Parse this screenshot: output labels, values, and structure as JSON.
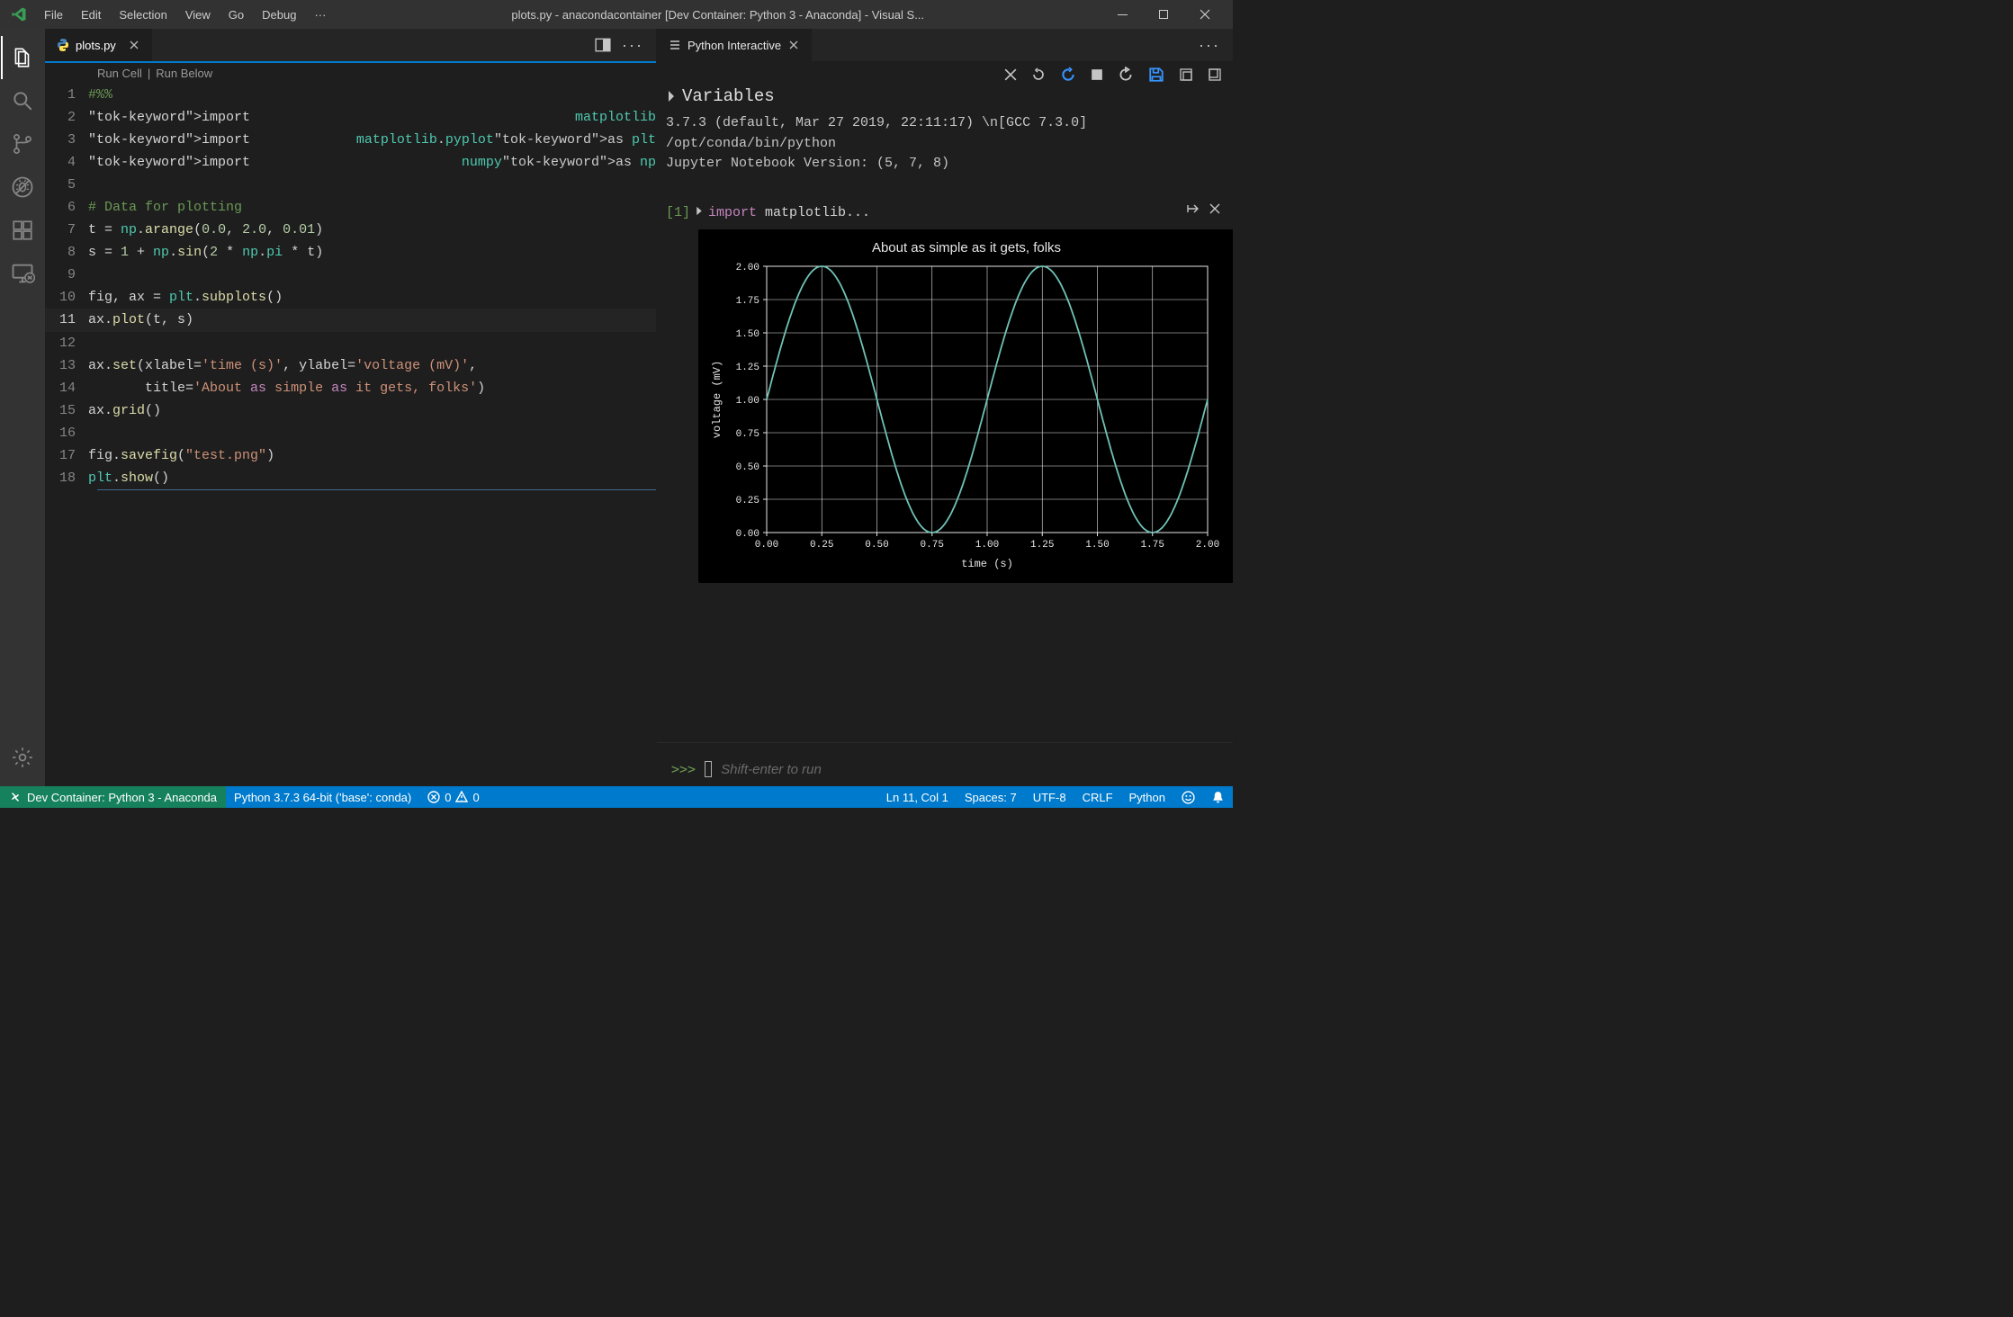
{
  "title_bar": {
    "title": "plots.py - anacondacontainer [Dev Container: Python 3 - Anaconda] - Visual S..."
  },
  "menu": {
    "file": "File",
    "edit": "Edit",
    "selection": "Selection",
    "view": "View",
    "go": "Go",
    "debug": "Debug",
    "more": "···"
  },
  "tabs": {
    "editor_tab": "plots.py",
    "interactive_tab": "Python Interactive"
  },
  "codelens": {
    "run_cell": "Run Cell",
    "sep": "|",
    "run_below": "Run Below"
  },
  "code_lines": [
    "#%%",
    "import matplotlib",
    "import matplotlib.pyplot as plt",
    "import numpy as np",
    "",
    "# Data for plotting",
    "t = np.arange(0.0, 2.0, 0.01)",
    "s = 1 + np.sin(2 * np.pi * t)",
    "",
    "fig, ax = plt.subplots()",
    "ax.plot(t, s)",
    "",
    "ax.set(xlabel='time (s)', ylabel='voltage (mV)',",
    "       title='About as simple as it gets, folks')",
    "ax.grid()",
    "",
    "fig.savefig(\"test.png\")",
    "plt.show()"
  ],
  "current_line_idx": 10,
  "interactive": {
    "variables_label": "Variables",
    "env_info": "3.7.3 (default, Mar 27 2019, 22:11:17) \\n[GCC 7.3.0]\n/opt/conda/bin/python\nJupyter Notebook Version: (5, 7, 8)",
    "cell_index": "[1]",
    "cell_code": "import matplotlib...",
    "prompt": ">>>",
    "prompt_hint": "Shift-enter to run"
  },
  "chart_data": {
    "type": "line",
    "title": "About as simple as it gets, folks",
    "xlabel": "time (s)",
    "ylabel": "voltage (mV)",
    "xlim": [
      0.0,
      2.0
    ],
    "ylim": [
      0.0,
      2.0
    ],
    "x_ticks": [
      0.0,
      0.25,
      0.5,
      0.75,
      1.0,
      1.25,
      1.5,
      1.75,
      2.0
    ],
    "y_ticks": [
      0.0,
      0.25,
      0.5,
      0.75,
      1.0,
      1.25,
      1.5,
      1.75,
      2.0
    ],
    "function": "y = 1 + sin(2*pi*x)",
    "series": [
      {
        "name": "voltage",
        "formula": "1 + sin(2*pi*t)",
        "samples_x": [
          0.0,
          0.1,
          0.2,
          0.25,
          0.3,
          0.4,
          0.5,
          0.6,
          0.7,
          0.75,
          0.8,
          0.9,
          1.0,
          1.1,
          1.2,
          1.25,
          1.3,
          1.4,
          1.5,
          1.6,
          1.7,
          1.75,
          1.8,
          1.9,
          2.0
        ],
        "samples_y": [
          1.0,
          1.59,
          1.95,
          2.0,
          1.95,
          1.59,
          1.0,
          0.41,
          0.05,
          0.0,
          0.05,
          0.41,
          1.0,
          1.59,
          1.95,
          2.0,
          1.95,
          1.59,
          1.0,
          0.41,
          0.05,
          0.0,
          0.05,
          0.41,
          1.0
        ]
      }
    ],
    "grid": true
  },
  "status": {
    "remote": "Dev Container: Python 3 - Anaconda",
    "python": "Python 3.7.3 64-bit ('base': conda)",
    "errors": "0",
    "warnings": "0",
    "ln_col": "Ln 11, Col 1",
    "spaces": "Spaces: 7",
    "encoding": "UTF-8",
    "eol": "CRLF",
    "lang": "Python"
  }
}
